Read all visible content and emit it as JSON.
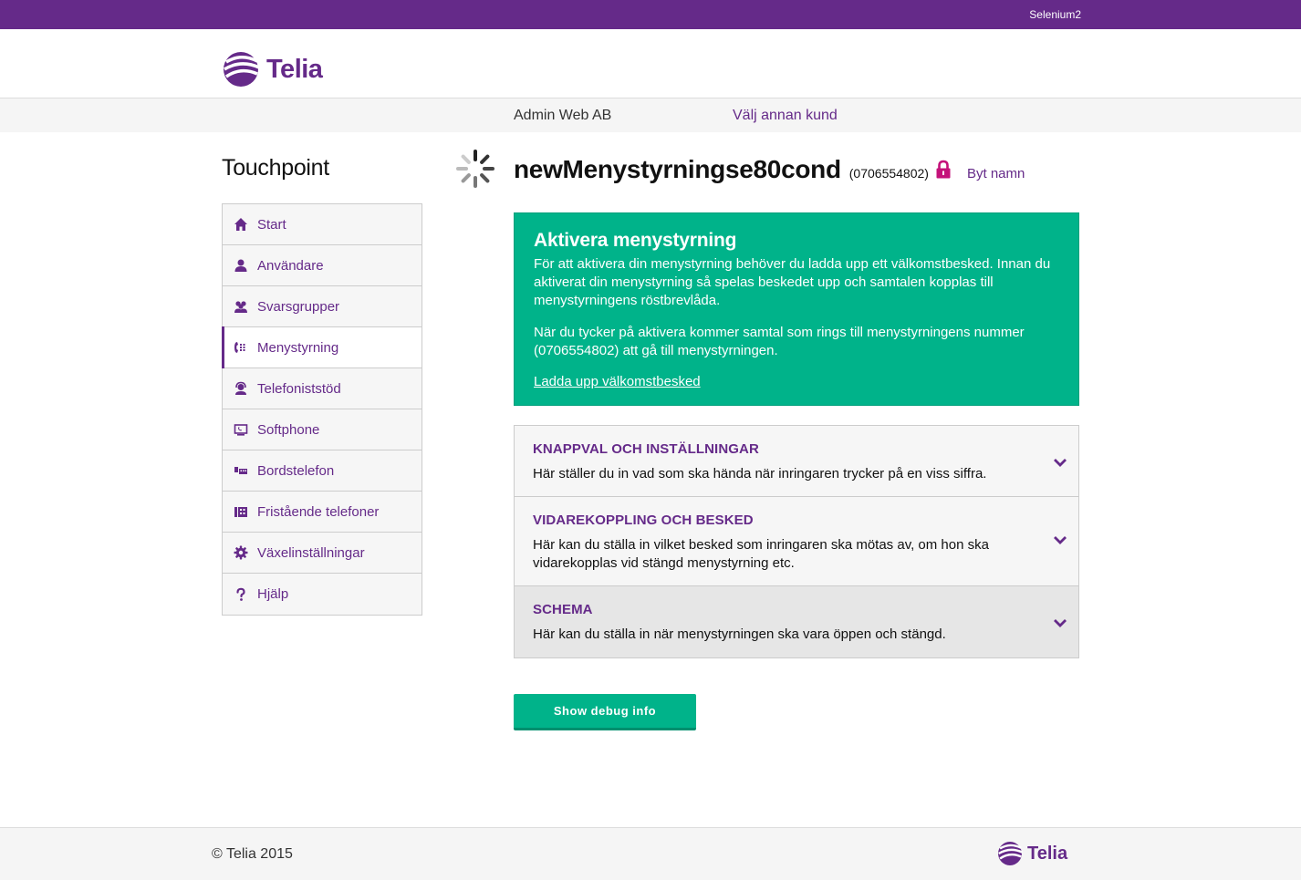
{
  "topbar": {
    "user": "Selenium2"
  },
  "brand": {
    "name": "Telia",
    "color": "#652a89",
    "accent": "#00b38a"
  },
  "customer": {
    "name": "Admin Web AB",
    "switch_label": "Välj annan kund"
  },
  "app_title": "Touchpoint",
  "nav": {
    "items": [
      {
        "label": "Start",
        "icon": "home-icon"
      },
      {
        "label": "Användare",
        "icon": "user-icon"
      },
      {
        "label": "Svarsgrupper",
        "icon": "group-icon"
      },
      {
        "label": "Menystyrning",
        "icon": "menu-phone-icon",
        "active": true
      },
      {
        "label": "Telefoniststöd",
        "icon": "headset-icon"
      },
      {
        "label": "Softphone",
        "icon": "screen-icon"
      },
      {
        "label": "Bordstelefon",
        "icon": "desk-phone-icon"
      },
      {
        "label": "Fristående telefoner",
        "icon": "phones-icon"
      },
      {
        "label": "Växelinställningar",
        "icon": "gear-icon"
      },
      {
        "label": "Hjälp",
        "icon": "question-icon"
      }
    ]
  },
  "page": {
    "title": "newMenystyrningse80cond",
    "number": "(0706554802)",
    "rename_label": "Byt namn"
  },
  "alert": {
    "title": "Aktivera menystyrning",
    "paragraph1": "För att aktivera din menystyrning behöver du ladda upp ett välkomstbesked. Innan du aktiverat din menystyrning så spelas beskedet upp och samtalen kopplas till menystyrningens röstbrevlåda.",
    "paragraph2": "När du tycker på aktivera kommer samtal som rings till menystyrningens nummer (0706554802) att gå till menystyrningen.",
    "link": "Ladda upp välkomstbesked"
  },
  "accordion": [
    {
      "title": "KNAPPVAL OCH INSTÄLLNINGAR",
      "text": "Här ställer du in vad som ska hända när inringaren trycker på en viss siffra."
    },
    {
      "title": "VIDAREKOPPLING OCH BESKED",
      "text": "Här kan du ställa in vilket besked som inringaren ska mötas av, om hon ska vidarekopplas vid stängd menystyrning etc."
    },
    {
      "title": "SCHEMA",
      "text": "Här kan du ställa in när menystyrningen ska vara öppen och stängd."
    }
  ],
  "debug_button": "Show debug info",
  "footer": {
    "copyright": "© Telia 2015",
    "logo_text": "Telia"
  }
}
